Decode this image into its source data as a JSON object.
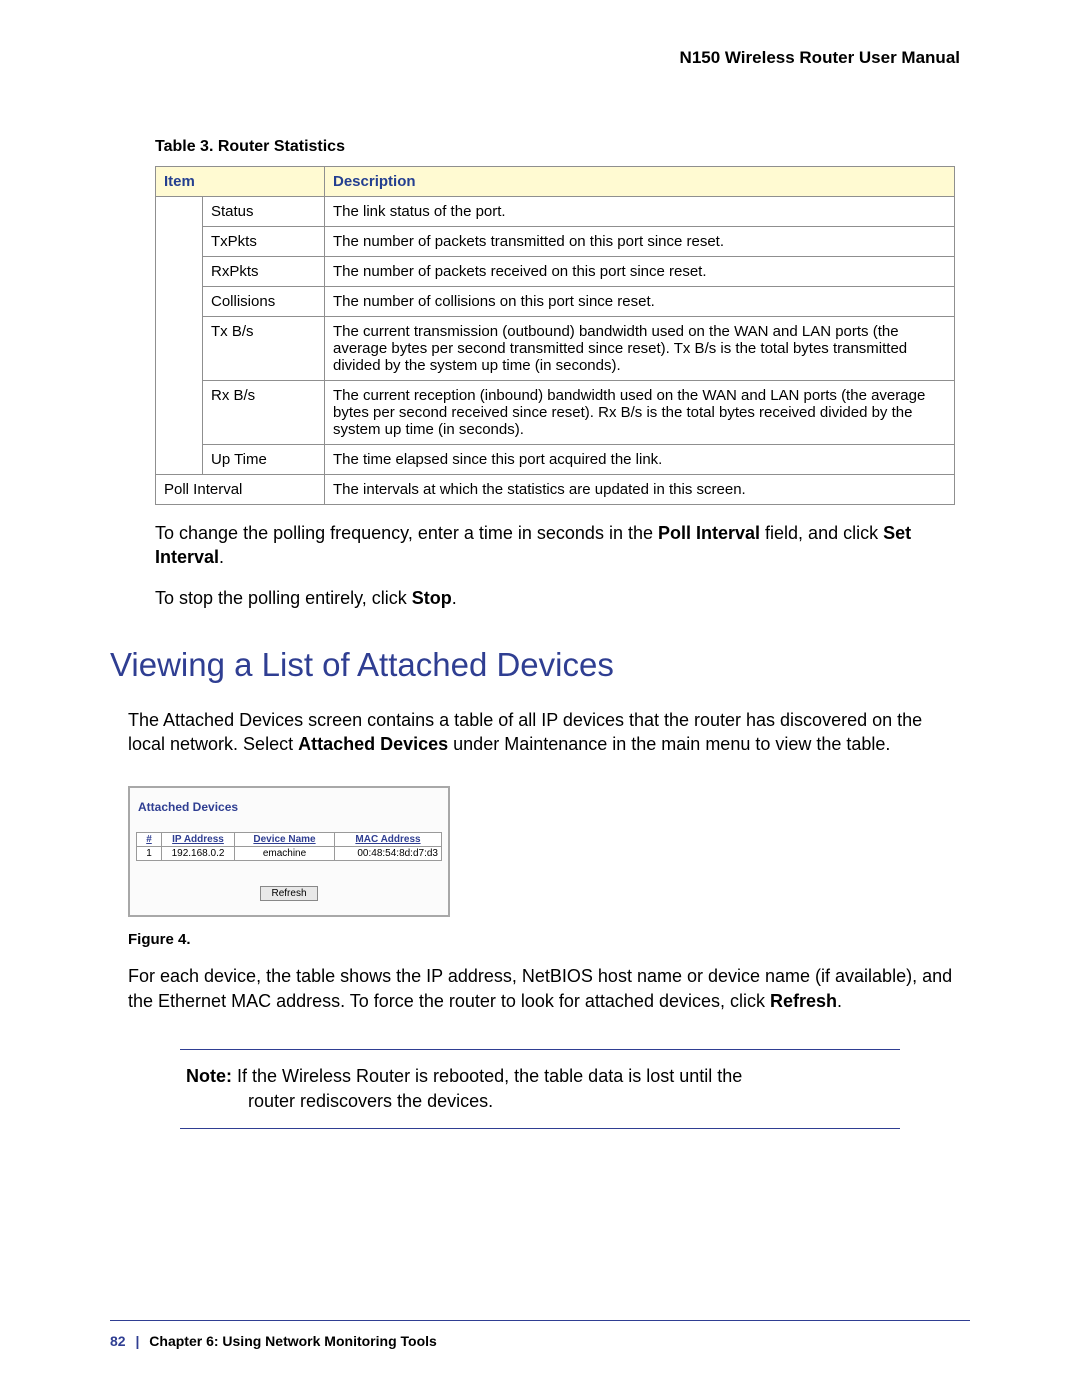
{
  "header": {
    "title": "N150 Wireless Router User Manual"
  },
  "table3": {
    "caption": "Table 3.  Router Statistics",
    "head": {
      "item": "Item",
      "desc": "Description"
    },
    "rows": [
      {
        "item": "Status",
        "desc": "The link status of the port."
      },
      {
        "item": "TxPkts",
        "desc": "The number of packets transmitted on this port since reset."
      },
      {
        "item": "RxPkts",
        "desc": "The number of packets received on this port since reset."
      },
      {
        "item": "Collisions",
        "desc": "The number of collisions on this port since reset."
      },
      {
        "item": "Tx B/s",
        "desc": "The current transmission (outbound) bandwidth used on the WAN and LAN ports (the average bytes per second transmitted since reset). Tx B/s is the total bytes transmitted divided by the system up time (in seconds)."
      },
      {
        "item": "Rx B/s",
        "desc": "The current reception (inbound) bandwidth used on the WAN and LAN ports (the average bytes per second received since reset). Rx B/s is the total bytes received divided by the system up time (in seconds)."
      },
      {
        "item": "Up Time",
        "desc": "The time elapsed since this port acquired the link."
      }
    ],
    "poll_row": {
      "item": "Poll Interval",
      "desc": "The intervals at which the statistics are updated in this screen."
    }
  },
  "para1": {
    "p1a": "To change the polling frequency, enter a time in seconds in the ",
    "p1b": "Poll Interval",
    "p1c": " field, and click ",
    "p1d": "Set Interval",
    "p1e": "."
  },
  "para2": {
    "a": "To stop the polling entirely, click ",
    "b": "Stop",
    "c": "."
  },
  "section": {
    "heading": "Viewing a List of Attached Devices"
  },
  "para3": {
    "a": "The Attached Devices screen contains a table of all IP devices that the router has discovered on the local network. Select ",
    "b": "Attached Devices",
    "c": " under Maintenance in the main menu to view the table."
  },
  "devices": {
    "title": "Attached Devices",
    "head": {
      "num": "#",
      "ip": "IP Address",
      "name": "Device Name",
      "mac": "MAC Address"
    },
    "row": {
      "num": "1",
      "ip": "192.168.0.2",
      "name": "emachine",
      "mac": "00:48:54:8d:d7:d3"
    },
    "refresh": "Refresh"
  },
  "figure": {
    "caption": "Figure 4."
  },
  "para4": {
    "a": "For each device, the table shows the IP address, NetBIOS host name or device name (if available), and the Ethernet MAC address. To force the router to look for attached devices, click ",
    "b": "Refresh",
    "c": "."
  },
  "note": {
    "label": "Note:",
    "line1": "  If the Wireless Router is rebooted, the table data is lost until the",
    "line2": "router rediscovers the devices."
  },
  "footer": {
    "page": "82",
    "sep": "|",
    "chapter": "Chapter 6:  Using Network Monitoring Tools"
  }
}
